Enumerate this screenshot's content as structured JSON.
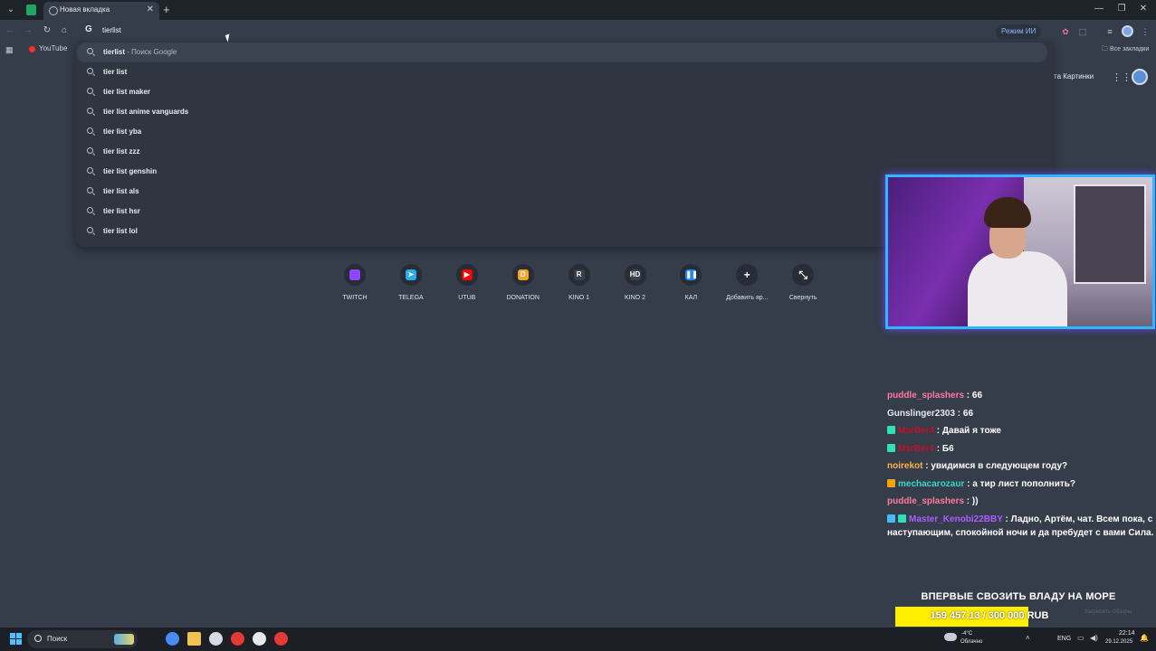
{
  "browser": {
    "active_tab_title": "Новая вкладка",
    "new_tab_symbol": "+",
    "close_symbol": "✕",
    "omnibox_value": "tierlist",
    "ai_mode_label": "Режим ИИ",
    "bookmarks": [
      {
        "label": "YouTube"
      }
    ],
    "all_bookmarks_label": "Все закладки"
  },
  "suggestions": [
    {
      "bold": "tierlist",
      "dim": " - Поиск Google",
      "selected": true
    },
    {
      "bold": "tier list",
      "dim": ""
    },
    {
      "bold": "tier list maker",
      "dim": ""
    },
    {
      "bold": "tier list anime vanguards",
      "dim": ""
    },
    {
      "bold": "tier list yba",
      "dim": ""
    },
    {
      "bold": "tier list zzz",
      "dim": ""
    },
    {
      "bold": "tier list genshin",
      "dim": ""
    },
    {
      "bold": "tier list als",
      "dim": ""
    },
    {
      "bold": "tier list hsr",
      "dim": ""
    },
    {
      "bold": "tier list lol",
      "dim": ""
    }
  ],
  "google_links": {
    "text": "та  Картинки"
  },
  "shortcuts": [
    {
      "label": "TWITCH",
      "color": "#9146ff",
      "glyph": ""
    },
    {
      "label": "TELEGA",
      "color": "#2aabee",
      "glyph": "➤"
    },
    {
      "label": "UTUB",
      "color": "#ff0000",
      "glyph": "▶"
    },
    {
      "label": "DONATION",
      "color": "#f5a623",
      "glyph": "D"
    },
    {
      "label": "KINO 1",
      "color": "#3a3f4a",
      "glyph": "R"
    },
    {
      "label": "KINO 2",
      "color": "#3a3f4a",
      "glyph": "HD"
    },
    {
      "label": "КАЛ",
      "color": "#1e88ff",
      "glyph": "❚❚"
    },
    {
      "label": "Добавить яр...",
      "color": "",
      "glyph": "+"
    },
    {
      "label": "Свернуть",
      "color": "",
      "glyph": "⤡"
    }
  ],
  "chat": [
    {
      "nick": "puddle_splashers",
      "nick_color": "#ff7aa0",
      "badges": [],
      "text": " : 66"
    },
    {
      "nick": "Gunslinger2303",
      "nick_color": "#e6e8ec",
      "badges": [],
      "text": " : 66"
    },
    {
      "nick": "MsrBer4",
      "nick_color": "#c4102a",
      "badges": [
        "#30e0b0"
      ],
      "text": " : Давай я тоже"
    },
    {
      "nick": "MsrBer4",
      "nick_color": "#c4102a",
      "badges": [
        "#30e0b0"
      ],
      "text": " : Б6"
    },
    {
      "nick": "noirekot",
      "nick_color": "#ffb347",
      "badges": [],
      "text": " : увидимся в следующем году?"
    },
    {
      "nick": "mechacarozaur",
      "nick_color": "#3ad7c7",
      "badges": [
        "#f0a500"
      ],
      "text": " : а тир лист пополнить?"
    },
    {
      "nick": "puddle_splashers",
      "nick_color": "#ff7aa0",
      "badges": [],
      "text": " : ))"
    },
    {
      "nick": "Master_Kenobi22BBY",
      "nick_color": "#b05cff",
      "badges": [
        "#4ab8ff",
        "#30e0b0"
      ],
      "text": " : Ладно, Артём, чат. Всем пока, с наступающим, спокойной ночи и да пребудет с вами Сила."
    }
  ],
  "goal": {
    "title": "ВПЕРВЫЕ СВОЗИТЬ ВЛАДУ НА МОРЕ",
    "current": 159457.13,
    "target": 300000,
    "text": "159 457.13 / 300 000 RUB",
    "fill_color": "#ffee00",
    "obs_hint": "Закрепить Обзоры"
  },
  "taskbar": {
    "search_label": "Поиск",
    "apps": [
      {
        "name": "chrome",
        "color": "#4a8af4"
      },
      {
        "name": "explorer",
        "color": "#f2c14e"
      },
      {
        "name": "app-circle",
        "color": "#d9d9e3"
      },
      {
        "name": "opera-like",
        "color": "#e53935"
      },
      {
        "name": "media",
        "color": "#e6e8ec"
      },
      {
        "name": "telegram-like",
        "color": "#e53935"
      }
    ],
    "weather_temp": "-4°C",
    "weather_cond": "Облачно",
    "lang": "ENG",
    "time": "22:14",
    "date": "29.12.2025"
  }
}
